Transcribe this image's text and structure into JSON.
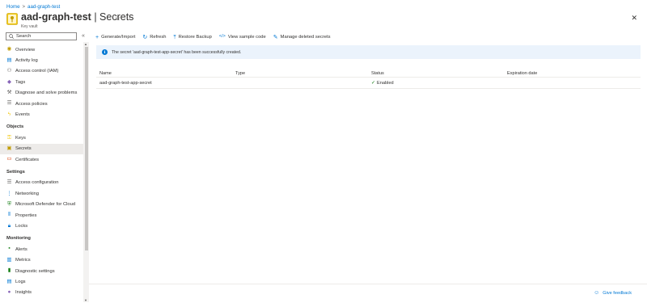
{
  "breadcrumb": {
    "home": "Home",
    "separator": ">",
    "current": "aad-graph-test"
  },
  "header": {
    "resource_name": "aad-graph-test",
    "divider": "|",
    "page_name": "Secrets",
    "subtitle": "Key vault"
  },
  "sidebar": {
    "search_placeholder": "Search",
    "items": [
      {
        "label": "Overview",
        "icon": "overview-icon"
      },
      {
        "label": "Activity log",
        "icon": "activity-log-icon"
      },
      {
        "label": "Access control (IAM)",
        "icon": "iam-icon"
      },
      {
        "label": "Tags",
        "icon": "tag-icon"
      },
      {
        "label": "Diagnose and solve problems",
        "icon": "wrench-icon"
      },
      {
        "label": "Access policies",
        "icon": "list-icon"
      },
      {
        "label": "Events",
        "icon": "lightning-icon"
      }
    ],
    "objects_header": "Objects",
    "objects": [
      {
        "label": "Keys",
        "icon": "key-icon"
      },
      {
        "label": "Secrets",
        "icon": "secret-icon",
        "active": true
      },
      {
        "label": "Certificates",
        "icon": "certificate-icon"
      }
    ],
    "settings_header": "Settings",
    "settings": [
      {
        "label": "Access configuration",
        "icon": "list-icon"
      },
      {
        "label": "Networking",
        "icon": "network-icon"
      },
      {
        "label": "Microsoft Defender for Cloud",
        "icon": "shield-icon"
      },
      {
        "label": "Properties",
        "icon": "properties-icon"
      },
      {
        "label": "Locks",
        "icon": "lock-icon"
      }
    ],
    "monitoring_header": "Monitoring",
    "monitoring": [
      {
        "label": "Alerts",
        "icon": "alert-icon"
      },
      {
        "label": "Metrics",
        "icon": "metrics-icon"
      },
      {
        "label": "Diagnostic settings",
        "icon": "diagnostic-icon"
      },
      {
        "label": "Logs",
        "icon": "logs-icon"
      },
      {
        "label": "Insights",
        "icon": "insights-icon"
      }
    ]
  },
  "toolbar": {
    "generate_import": "Generate/Import",
    "refresh": "Refresh",
    "restore_backup": "Restore Backup",
    "view_sample_code": "View sample code",
    "manage_deleted": "Manage deleted secrets"
  },
  "notice": {
    "text": "The secret 'aad-graph-test-app-secret' has been successfully created."
  },
  "table": {
    "columns": [
      "Name",
      "Type",
      "Status",
      "Expiration date"
    ],
    "rows": [
      {
        "name": "aad-graph-test-app-secret",
        "type": "",
        "status": "Enabled",
        "expiration": ""
      }
    ]
  },
  "footer": {
    "feedback": "Give feedback"
  },
  "colors": {
    "accent": "#0078d4",
    "notice_bg": "#ebf3fc",
    "success": "#107c10"
  }
}
